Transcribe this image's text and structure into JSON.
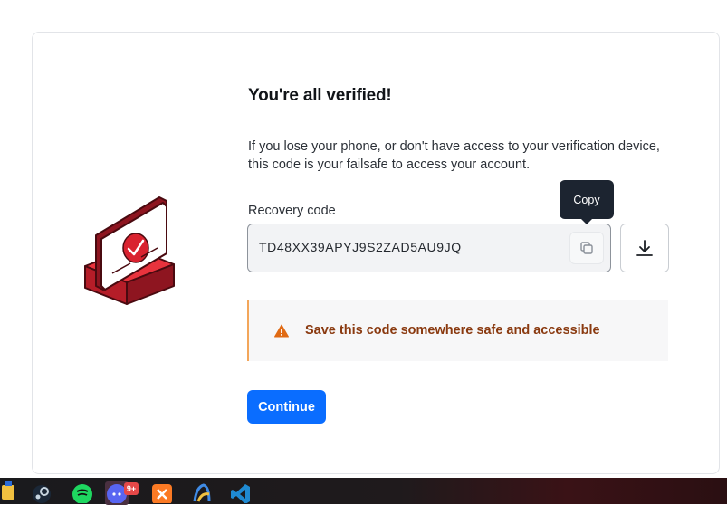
{
  "page": {
    "title": "You're all verified!",
    "description": "If you lose your phone, or don't have access to your verification device, this code is your failsafe to access your account."
  },
  "recovery": {
    "label": "Recovery code",
    "code": "TD48XX39APYJ9S2ZAD5AU9JQ",
    "copy_tooltip": "Copy",
    "copy_icon": "copy-icon",
    "download_icon": "download-icon"
  },
  "alert": {
    "icon": "warning-icon",
    "text": "Save this code somewhere safe and accessible"
  },
  "actions": {
    "continue_label": "Continue"
  },
  "taskbar": {
    "apps": [
      "steam",
      "spotify",
      "discord",
      "xampp",
      "app",
      "vscode"
    ],
    "discord_badge": "9+"
  },
  "colors": {
    "primary": "#0a6dff",
    "warning": "#e06a14",
    "warning_text": "#8a3a10",
    "alert_border": "#f3a65a",
    "illustration_red": "#d9222f"
  }
}
